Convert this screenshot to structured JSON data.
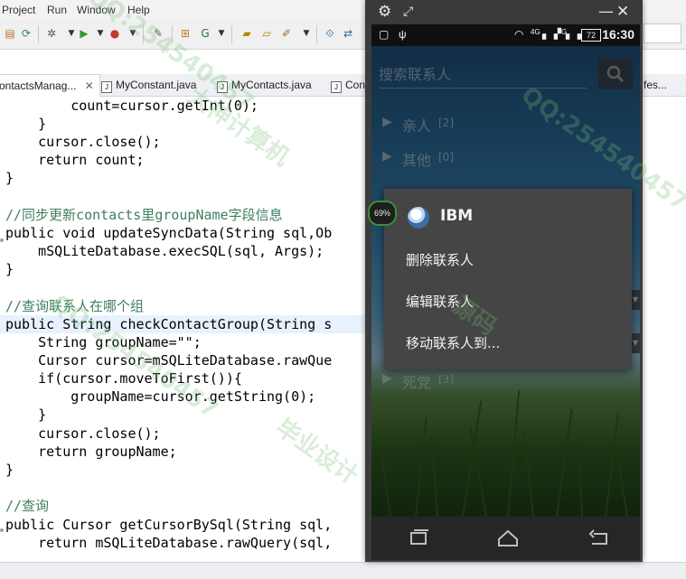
{
  "eclipse": {
    "menu": [
      "Project",
      "Run",
      "Window",
      "Help"
    ],
    "tabs": [
      {
        "label": "ontactsManag...",
        "active": true
      },
      {
        "label": "MyConstant.java",
        "active": false
      },
      {
        "label": "MyContacts.java",
        "active": false
      },
      {
        "label": "Cont",
        "active": false
      },
      {
        "label": "fes...",
        "active": false
      }
    ],
    "code_lines": [
      "        count=cursor.getInt(0);",
      "    }",
      "    cursor.close();",
      "    return count;",
      "}",
      "",
      "//同步更新contacts里groupName字段信息",
      "public void updateSyncData(String sql,Ob",
      "    mSQLiteDatabase.execSQL(sql, Args);",
      "}",
      "",
      "//查询联系人在哪个组",
      "public String checkContactGroup(String s",
      "    String groupName=\"\";",
      "    Cursor cursor=mSQLiteDatabase.rawQue",
      "    if(cursor.moveToFirst()){",
      "        groupName=cursor.getString(0);",
      "    }",
      "    cursor.close();",
      "    return groupName;",
      "}",
      "",
      "//查询",
      "public Cursor getCursorBySql(String sql,",
      "    return mSQLiteDatabase.rawQuery(sql,"
    ]
  },
  "emulator": {
    "status": {
      "time": "16:30",
      "battery": "72",
      "network": "4G",
      "network2": "G"
    },
    "cpu_percent": "69%",
    "search": {
      "placeholder": "搜索联系人"
    },
    "groups": [
      {
        "name": "亲人",
        "count": "[2]"
      },
      {
        "name": "其他",
        "count": "[0]"
      },
      {
        "name": "死党",
        "count": "[3]"
      }
    ],
    "context_menu": {
      "title": "IBM",
      "items": [
        "删除联系人",
        "编辑联系人",
        "移动联系人到..."
      ]
    }
  },
  "watermarks": [
    "QQ:254540457",
    "大神计算机",
    "毕业设计",
    "源码"
  ]
}
